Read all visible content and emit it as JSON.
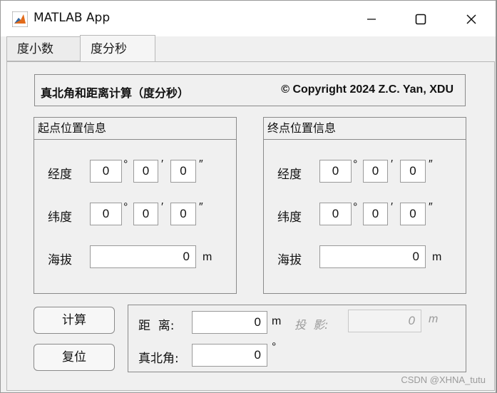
{
  "window": {
    "title": "MATLAB App"
  },
  "tabs": [
    {
      "label": "度小数"
    },
    {
      "label": "度分秒"
    }
  ],
  "header": {
    "title": "真北角和距离计算（度分秒）",
    "copyright": "© Copyright 2024 Z.C. Yan, XDU"
  },
  "start": {
    "title": "起点位置信息",
    "lon_label": "经度",
    "lat_label": "纬度",
    "alt_label": "海拔",
    "lon_deg": "0",
    "lon_min": "0",
    "lon_sec": "0",
    "lat_deg": "0",
    "lat_min": "0",
    "lat_sec": "0",
    "alt": "0"
  },
  "end": {
    "title": "终点位置信息",
    "lon_label": "经度",
    "lat_label": "纬度",
    "alt_label": "海拔",
    "lon_deg": "0",
    "lon_min": "0",
    "lon_sec": "0",
    "lat_deg": "0",
    "lat_min": "0",
    "lat_sec": "0",
    "alt": "0"
  },
  "units": {
    "deg": "°",
    "min": "′",
    "sec": "″",
    "meter": "m"
  },
  "buttons": {
    "calc": "计算",
    "reset": "复位"
  },
  "result": {
    "distance_label": "距  离:",
    "distance": "0",
    "projection_label": "投  影:",
    "projection": "0",
    "azimuth_label": "真北角:",
    "azimuth": "0"
  },
  "watermark": "CSDN @XHNA_tutu"
}
